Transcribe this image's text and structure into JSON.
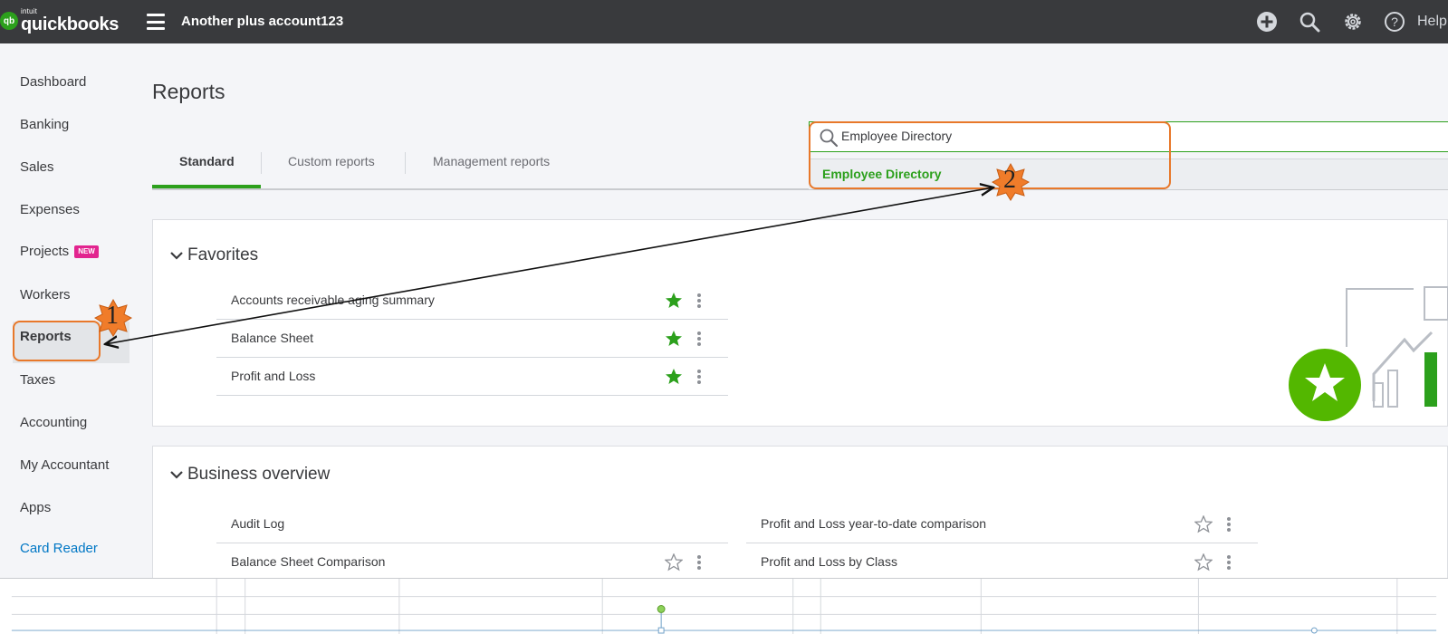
{
  "topbar": {
    "logo_intuit": "intuit",
    "logo_brand": "quickbooks",
    "logo_mark": "qb",
    "company_name": "Another plus account123",
    "help_label": "Help",
    "icons": [
      "plus-icon",
      "search-icon",
      "gear-icon",
      "help-icon"
    ]
  },
  "sidebar": {
    "items": [
      {
        "label": "Dashboard"
      },
      {
        "label": "Banking"
      },
      {
        "label": "Sales"
      },
      {
        "label": "Expenses"
      },
      {
        "label": "Projects",
        "badge": "NEW"
      },
      {
        "label": "Workers"
      },
      {
        "label": "Reports",
        "active": true
      },
      {
        "label": "Taxes"
      },
      {
        "label": "Accounting"
      },
      {
        "label": "My Accountant"
      },
      {
        "label": "Apps"
      },
      {
        "label": "Card Reader"
      }
    ]
  },
  "main": {
    "title": "Reports",
    "tabs": [
      {
        "label": "Standard",
        "active": true
      },
      {
        "label": "Custom reports"
      },
      {
        "label": "Management reports"
      }
    ],
    "search": {
      "value": "Employee Directory",
      "suggestion": "Employee Directory"
    },
    "favorites": {
      "title": "Favorites",
      "items": [
        {
          "label": "Accounts receivable aging summary",
          "starred": true
        },
        {
          "label": "Balance Sheet",
          "starred": true
        },
        {
          "label": "Profit and Loss",
          "starred": true
        }
      ]
    },
    "business_overview": {
      "title": "Business overview",
      "left": [
        {
          "label": "Audit Log",
          "starred": false
        },
        {
          "label": "Balance Sheet Comparison",
          "starred": false
        }
      ],
      "right": [
        {
          "label": "Profit and Loss year-to-date comparison",
          "starred": false
        },
        {
          "label": "Profit and Loss by Class",
          "starred": false
        }
      ]
    }
  },
  "annotations": [
    {
      "number": "1"
    },
    {
      "number": "2"
    }
  ],
  "colors": {
    "topbar": "#393a3d",
    "accent_green": "#2ca01c",
    "annotation_orange": "#e8782a",
    "badge_pink": "#e2248f"
  }
}
